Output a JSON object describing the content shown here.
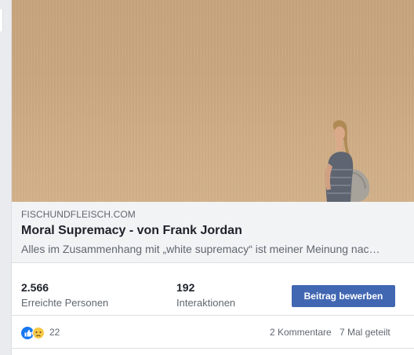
{
  "link_preview": {
    "domain": "FISCHUNDFLEISCH.COM",
    "title": "Moral Supremacy - von Frank Jordan",
    "description": "Alles im Zusammenhang mit „white supremacy“ ist meiner Meinung nac…"
  },
  "insights": {
    "reach_value": "2.566",
    "reach_label": "Erreichte Personen",
    "engagement_value": "192",
    "engagement_label": "Interaktionen",
    "boost_label": "Beitrag bewerben"
  },
  "reactions": {
    "count": "22",
    "icons": [
      "like-icon",
      "sad-icon"
    ],
    "comments": "2 Kommentare",
    "shares": "7 Mal geteilt"
  },
  "colors": {
    "accent": "#4267b2",
    "like_blue": "#1877f2",
    "sad_yellow": "#f7c947",
    "hero_sand": "#c9a67f"
  }
}
